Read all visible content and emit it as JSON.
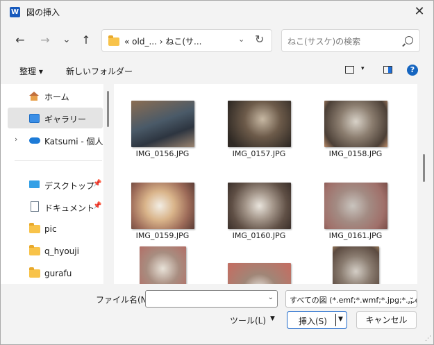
{
  "titlebar": {
    "app_icon": "W",
    "title": "図の挿入",
    "close": "✕"
  },
  "nav": {
    "back": "←",
    "forward": "→",
    "recent": "⌄",
    "up": "↑"
  },
  "address": {
    "path": "« old_...  ›  ねこ(サ...",
    "dropdown": "⌄",
    "refresh": "↻"
  },
  "search": {
    "placeholder": "ねこ(サスケ)の検索"
  },
  "toolbar": {
    "organize": "整理 ▾",
    "new_folder": "新しいフォルダー",
    "view_drop": "▾",
    "help": "?"
  },
  "sidebar": {
    "items": [
      {
        "label": "ホーム"
      },
      {
        "label": "ギャラリー"
      },
      {
        "label": "Katsumi - 個人用",
        "expand": "›"
      },
      {
        "label": "デスクトップ",
        "pin": "📌"
      },
      {
        "label": "ドキュメント",
        "pin": "📌"
      },
      {
        "label": "pic"
      },
      {
        "label": "q_hyouji"
      },
      {
        "label": "gurafu"
      }
    ]
  },
  "files": [
    {
      "name": "IMG_0156.JPG"
    },
    {
      "name": "IMG_0157.JPG"
    },
    {
      "name": "IMG_0158.JPG"
    },
    {
      "name": "IMG_0159.JPG"
    },
    {
      "name": "IMG_0160.JPG"
    },
    {
      "name": "IMG_0161.JPG"
    },
    {
      "name": ""
    },
    {
      "name": ""
    },
    {
      "name": ""
    }
  ],
  "bottom": {
    "filename_label": "ファイル名(N):",
    "filename_value": "",
    "filter": "すべての図 (*.emf;*.wmf;*.jpg;*.jpeg;*.png)",
    "tools": "ツール(L)",
    "insert": "挿入(S)",
    "cancel": "キャンセル"
  },
  "colors": {
    "accent": "#1b66c9",
    "selected": "#e4e4e4"
  }
}
